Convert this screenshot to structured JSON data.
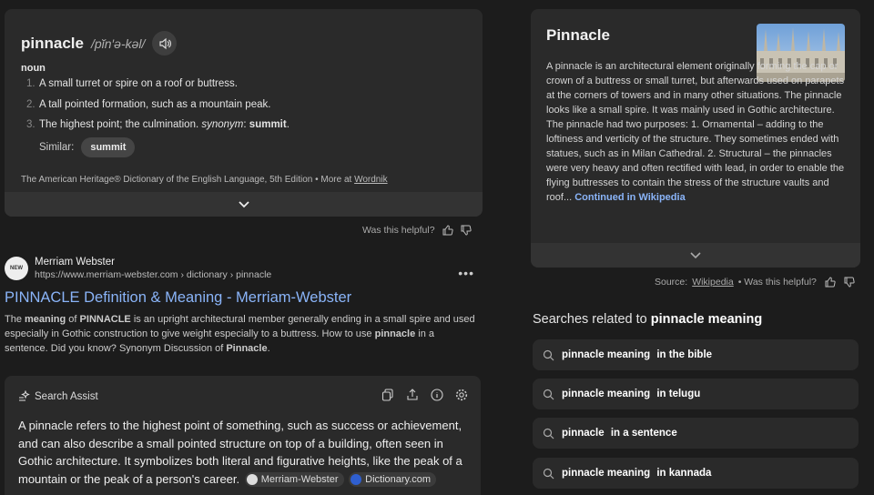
{
  "dictionary": {
    "word": "pinnacle",
    "pronunciation": "/pĭn′ə-kəl/",
    "part_of_speech": "noun",
    "definitions": [
      {
        "num": "1.",
        "text": "A small turret or spire on a roof or buttress."
      },
      {
        "num": "2.",
        "text": "A tall pointed formation, such as a mountain peak."
      },
      {
        "num": "3.",
        "text": "The highest point; the culmination."
      }
    ],
    "synonym_label": "synonym",
    "synonym_word": "summit",
    "similar_label": "Similar:",
    "similar_chip": "summit",
    "attribution": "The American Heritage® Dictionary of the English Language, 5th Edition •",
    "more_at": "More at",
    "more_link": "Wordnik"
  },
  "helpful_1": "Was this helpful?",
  "result": {
    "site_name": "Merriam Webster",
    "favicon_text": "NEW",
    "url": "https://www.merriam-webster.com › dictionary › pinnacle",
    "title": "PINNACLE Definition & Meaning - Merriam-Webster",
    "snippet_parts": [
      "The ",
      "meaning",
      " of ",
      "PINNACLE",
      " is an upright architectural member generally ending in a small spire and used especially in Gothic construction to give weight especially to a buttress. How to use ",
      "pinnacle",
      " in a sentence. Did you know? Synonym Discussion of ",
      "Pinnacle",
      "."
    ]
  },
  "assist": {
    "label": "Search Assist",
    "body": "A pinnacle refers to the highest point of something, such as success or achievement, and can also describe a small pointed structure on top of a building, often seen in Gothic architecture. It symbolizes both literal and figurative heights, like the peak of a mountain or the peak of a person's career.",
    "sources": [
      "Merriam-Webster",
      "Dictionary.com"
    ]
  },
  "wiki": {
    "title": "Pinnacle",
    "text": "A pinnacle is an architectural element originally forming the cap or crown of a buttress or small turret, but afterwards used on parapets at the corners of towers and in many other situations. The pinnacle looks like a small spire. It was mainly used in Gothic architecture. The pinnacle had two purposes: 1. Ornamental – adding to the loftiness and verticity of the structure. They sometimes ended with statues, such as in Milan Cathedral. 2. Structural – the pinnacles were very heavy and often rectified with lead, in order to enable the flying buttresses to contain the stress of the structure vaults and roof...",
    "continued": "Continued in Wikipedia",
    "source_label": "Source:",
    "source_link": "Wikipedia",
    "helpful": "• Was this helpful?"
  },
  "related": {
    "heading_prefix": "Searches related to",
    "heading_bold": "pinnacle meaning",
    "items": [
      {
        "plain": "pinnacle meaning",
        "bold": "in the bible"
      },
      {
        "plain": "pinnacle meaning",
        "bold": "in telugu"
      },
      {
        "plain": "pinnacle",
        "bold": "in a sentence"
      },
      {
        "plain": "pinnacle meaning",
        "bold": "in kannada"
      }
    ]
  }
}
